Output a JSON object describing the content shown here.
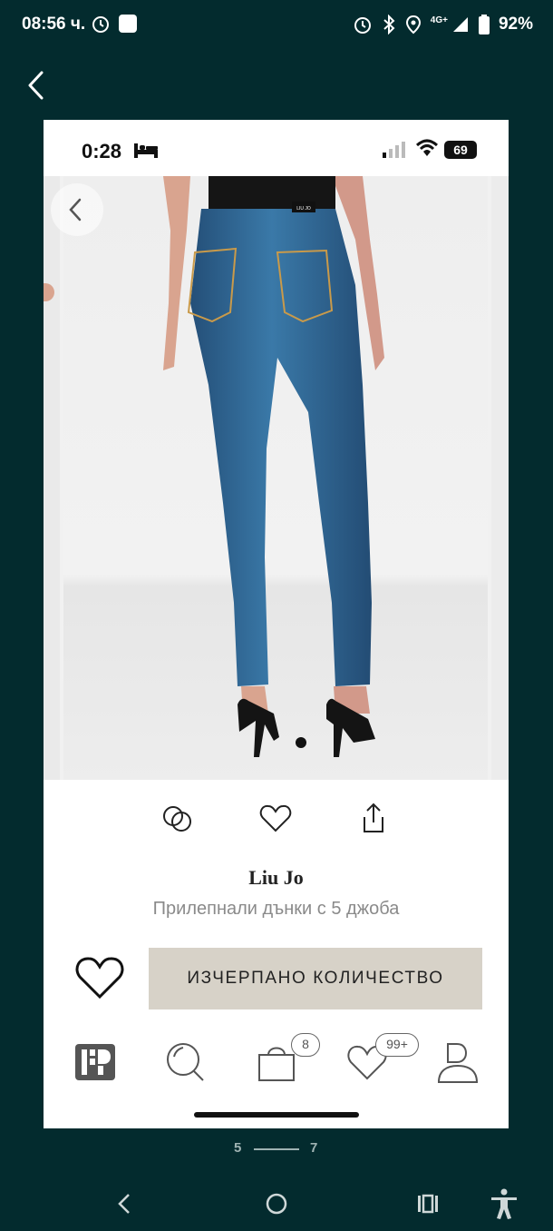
{
  "status_bar": {
    "time": "08:56 ч.",
    "network": "4G+",
    "battery": "92%",
    "icons": [
      "alarm-icon",
      "notification-square-icon",
      "bluetooth-icon",
      "location-icon",
      "signal-icon",
      "battery-icon"
    ]
  },
  "inner_status": {
    "time": "0:28",
    "battery": "69"
  },
  "product": {
    "brand": "Liu Jo",
    "description": "Прилепнали дънки с 5 джоба",
    "image_label": "LIU JO",
    "gallery_dots": 2,
    "active_dot": 0
  },
  "actions": [
    "compare-icon",
    "heart-icon",
    "share-icon"
  ],
  "buy": {
    "button_label": "ИЗЧЕРПАНО КОЛИЧЕСТВО"
  },
  "tabbar": {
    "cart_badge": "8",
    "favorites_badge": "99+"
  },
  "pager": {
    "from": "5",
    "to": "7"
  },
  "colors": {
    "background": "#032b2e",
    "button": "#d7d2c8",
    "denim": "#2f6a9a"
  }
}
